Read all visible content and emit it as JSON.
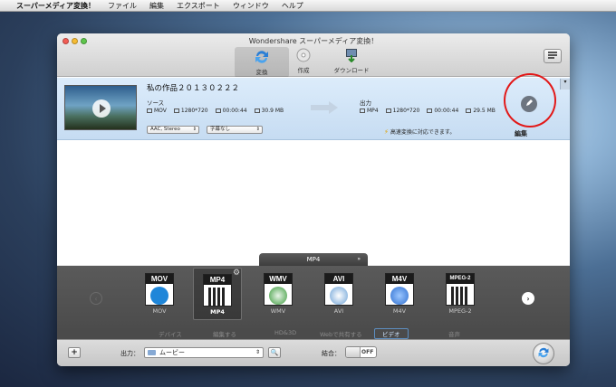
{
  "menubar": {
    "app_name": "スーパーメディア変換！",
    "items": [
      "ファイル",
      "編集",
      "エクスポート",
      "ウィンドウ",
      "ヘルプ"
    ]
  },
  "window": {
    "title": "Wondershare スーパーメディア変換！",
    "toolbar": [
      {
        "label": "変換",
        "icon": "convert-icon",
        "active": true
      },
      {
        "label": "作成",
        "icon": "disc-icon",
        "active": false
      },
      {
        "label": "ダウンロード",
        "icon": "download-icon",
        "active": false
      }
    ]
  },
  "task": {
    "title": "私の作品２０１３０２２２",
    "source_label": "ソース",
    "output_label": "出力",
    "source": {
      "format": "MOV",
      "resolution": "1280*720",
      "duration": "00:00:44",
      "size": "30.9 MB"
    },
    "output": {
      "format": "MP4",
      "resolution": "1280*720",
      "duration": "00:00:44",
      "size": "29.5 MB"
    },
    "audio_select": "AAC, Stereo",
    "subtitle_select": "字幕なし",
    "fast_note": "高速変換に対応できます。",
    "edit_label": "編集"
  },
  "format_panel": {
    "current_tab": "MP4",
    "formats": [
      {
        "badge": "MOV",
        "name": "MOV",
        "color": "#1f86d9",
        "selected": false
      },
      {
        "badge": "MP4",
        "name": "MP4",
        "color": "#2a2a2a",
        "selected": true
      },
      {
        "badge": "WMV",
        "name": "WMV",
        "color": "#3a9a3a",
        "selected": false
      },
      {
        "badge": "AVI",
        "name": "AVI",
        "color": "#6aa0d6",
        "selected": false
      },
      {
        "badge": "M4V",
        "name": "M4V",
        "color": "#2f6fd0",
        "selected": false
      },
      {
        "badge": "MPEG-2",
        "name": "MPEG-2",
        "color": "#1b1b1b",
        "selected": false
      }
    ],
    "categories": [
      "デバイス",
      "編集する",
      "HD&3D",
      "Webで共有する",
      "ビデオ",
      "音声"
    ],
    "active_category": "ビデオ"
  },
  "bottombar": {
    "output_label": "出力：",
    "output_value": "ムービー",
    "merge_label": "結合：",
    "merge_state": "OFF"
  },
  "colors": {
    "selection_row": "#c6dcf2",
    "highlight_ring": "#e21818",
    "panel_bg": "#4a4a4a"
  }
}
